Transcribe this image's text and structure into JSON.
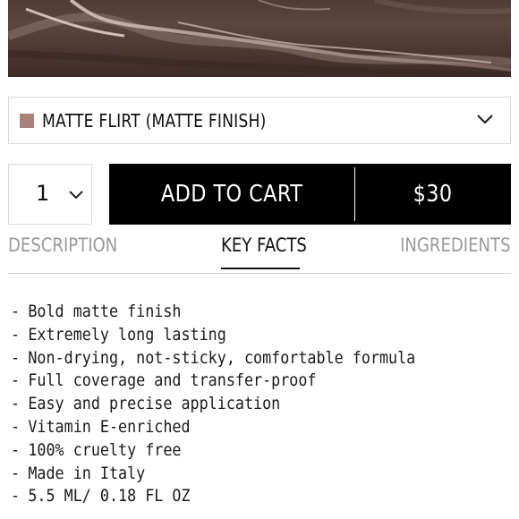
{
  "product": {
    "shade": {
      "label": "MATTE FLIRT (MATTE FINISH)",
      "color": "#a9837a"
    }
  },
  "purchase": {
    "quantity": "1",
    "add_to_cart_label": "ADD TO CART",
    "price": "$30"
  },
  "tabs": [
    {
      "label": "DESCRIPTION",
      "active": false
    },
    {
      "label": "KEY FACTS",
      "active": true
    },
    {
      "label": "INGREDIENTS",
      "active": false
    }
  ],
  "key_facts": {
    "bullet": "-",
    "items": [
      "Bold matte finish",
      "Extremely long lasting",
      "Non-drying, not-sticky, comfortable formula",
      "Full coverage and transfer-proof",
      "Easy and precise application",
      "Vitamin E-enriched",
      "100% cruelty free",
      "Made in Italy",
      "5.5 ML/ 0.18 FL OZ"
    ]
  },
  "colors": {
    "swatch_base": "#4f3b35",
    "button_bg": "#000000",
    "inactive_tab": "#9a9a9a"
  }
}
